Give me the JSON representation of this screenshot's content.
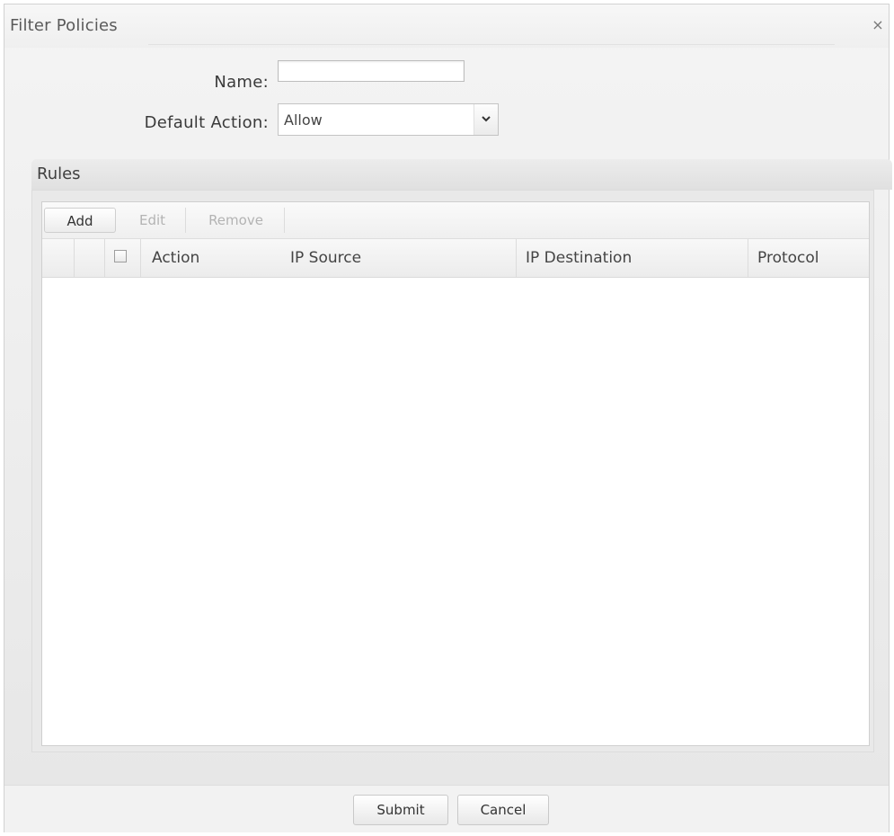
{
  "dialog": {
    "title": "Filter Policies",
    "close_icon": "close-icon"
  },
  "form": {
    "name_label": "Name:",
    "name_value": "",
    "default_action_label": "Default Action:",
    "default_action_value": "Allow",
    "dropdown_icon": "chevron-down-icon"
  },
  "rules": {
    "title": "Rules",
    "toolbar": {
      "add": "Add",
      "edit": "Edit",
      "remove": "Remove"
    },
    "columns": {
      "action": "Action",
      "ip_source": "IP Source",
      "ip_destination": "IP Destination",
      "protocol": "Protocol"
    },
    "select_all_checked": false,
    "rows": []
  },
  "footer": {
    "submit": "Submit",
    "cancel": "Cancel"
  }
}
